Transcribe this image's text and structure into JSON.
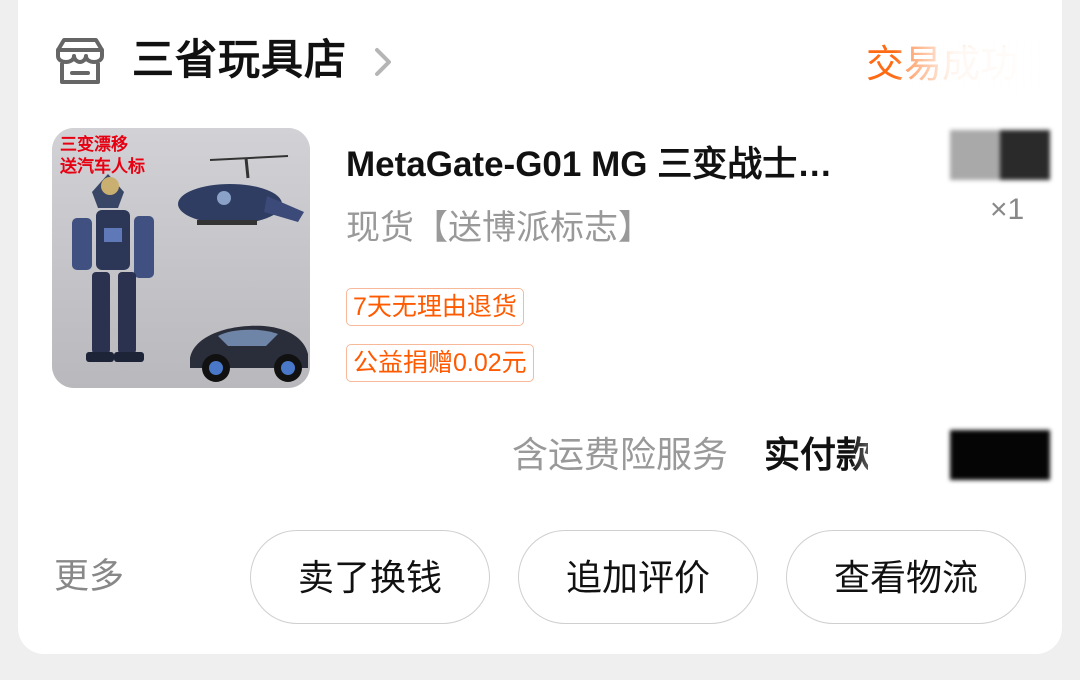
{
  "shop": {
    "name": "三省玩具店",
    "icon": "storefront-icon",
    "chevron_icon": "chevron-right-icon"
  },
  "order": {
    "status": "交易成功",
    "status_color": "#ff6a13"
  },
  "product": {
    "title": "MetaGate-G01 MG 三变战士…",
    "spec": "现货【送博派标志】",
    "quantity": "×1",
    "thumbnail_caption_line1": "三变漂移",
    "thumbnail_caption_line2": "送汽车人标",
    "tags": {
      "return_policy": "7天无理由退货",
      "charity": "公益捐赠0.02元"
    }
  },
  "summary": {
    "freight_note": "含运费险服务",
    "paid_label": "实付款"
  },
  "footer": {
    "more_label": "更多",
    "buttons": {
      "sell": "卖了换钱",
      "review": "追加评价",
      "logistics": "查看物流"
    }
  },
  "colors": {
    "accent": "#ff6a13",
    "tag_text": "#ff5a00",
    "tag_border": "#f7b999"
  }
}
